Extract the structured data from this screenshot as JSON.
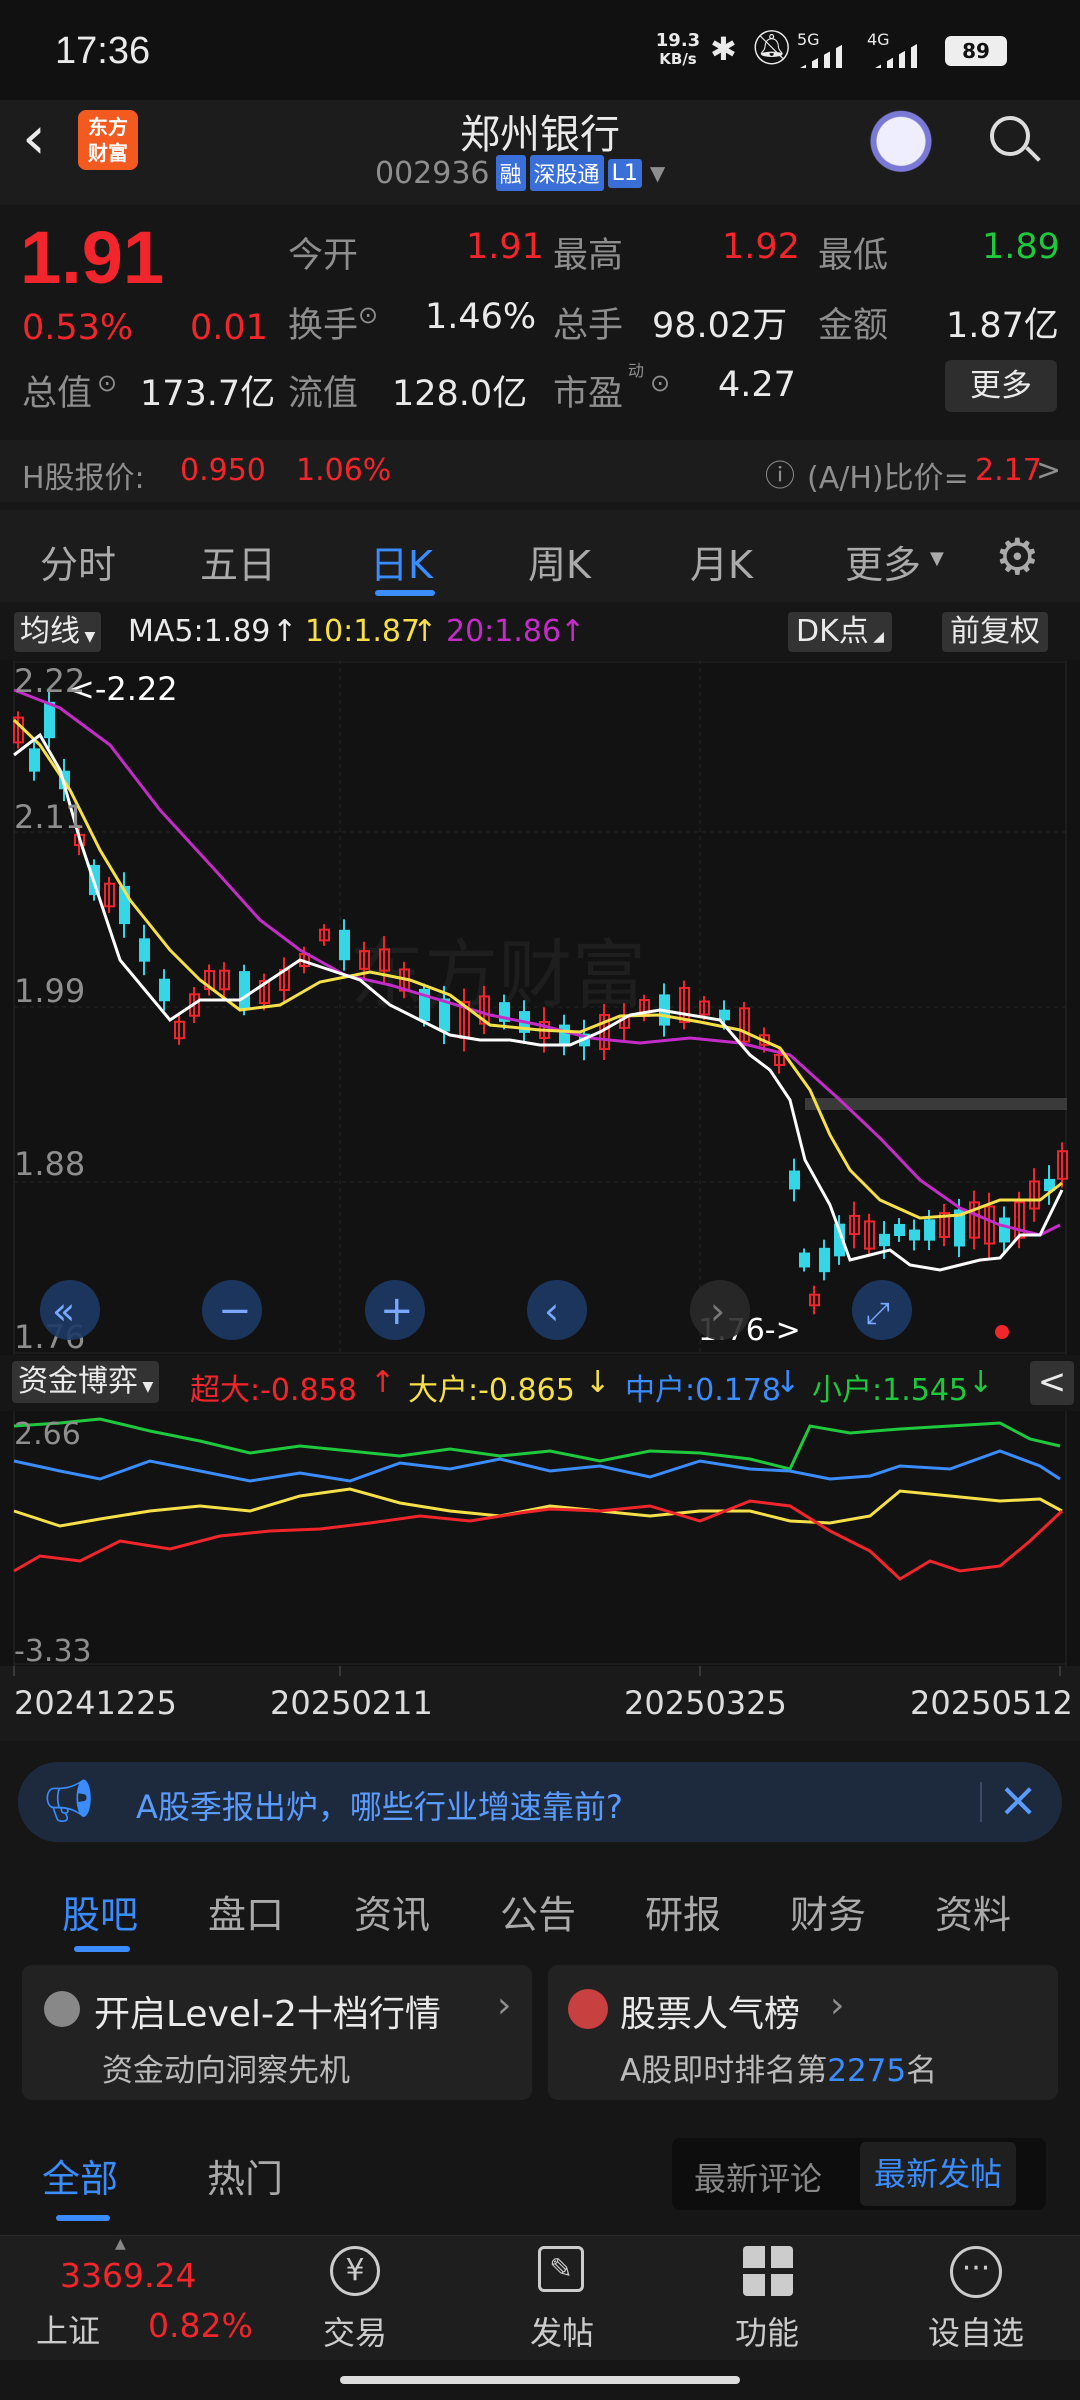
{
  "status": {
    "time": "17:36",
    "speed_top": "19.3",
    "speed_unit": "KB/s",
    "sig1": "5G",
    "sig2": "4G",
    "battery": "89"
  },
  "header": {
    "logo_line1": "东方",
    "logo_line2": "财富",
    "stock_name": "郑州银行",
    "code": "002936",
    "tag_margin": "融",
    "tag_connect": "深股通",
    "tag_level": "L1"
  },
  "quote": {
    "price": "1.91",
    "pct": "0.53%",
    "chg": "0.01",
    "open_label": "今开",
    "open": "1.91",
    "high_label": "最高",
    "high": "1.92",
    "low_label": "最低",
    "low": "1.89",
    "turnover_label": "换手",
    "turnover": "1.46%",
    "volume_label": "总手",
    "volume": "98.02万",
    "amount_label": "金额",
    "amount": "1.87亿",
    "mktcap_label": "总值",
    "mktcap": "173.7亿",
    "float_label": "流值",
    "float": "128.0亿",
    "pe_label": "市盈",
    "pe_sup": "动",
    "pe": "4.27",
    "more": "更多"
  },
  "hshare": {
    "label": "H股报价:",
    "price": "0.950",
    "pct": "1.06%",
    "ah_label": "(A/H)比价=",
    "ah_value": "2.17",
    "arrow": ">"
  },
  "tabs": [
    "分时",
    "五日",
    "日K",
    "周K",
    "月K",
    "更多"
  ],
  "active_tab": "日K",
  "ma_bar": {
    "selector": "均线",
    "ma5": "MA5:1.89",
    "ma10": "10:1.87",
    "ma20": "20:1.86",
    "up": "↑",
    "dk": "DK点",
    "adjust": "前复权"
  },
  "kchart": {
    "y_labels": [
      "2.22",
      "2.11",
      "1.99",
      "1.88",
      "1.76"
    ],
    "max_note": "<-2.22",
    "min_note": "1.76->",
    "watermark": "东方财富"
  },
  "flow_bar": {
    "selector": "资金博弈",
    "super": "超大:-0.858",
    "super_arrow": "↑",
    "large": "大户:-0.865",
    "large_arrow": "↓",
    "mid": "中户:0.178",
    "mid_arrow": "↓",
    "small": "小户:1.545",
    "small_arrow": "↓",
    "collapse": "<"
  },
  "flow_chart": {
    "y_top": "2.66",
    "y_bottom": "-3.33"
  },
  "dates": [
    "20241225",
    "20250211",
    "20250325",
    "20250512"
  ],
  "banner": {
    "text": "A股季报出炉，哪些行业增速靠前?",
    "close": "×"
  },
  "section_tabs": [
    "股吧",
    "盘口",
    "资讯",
    "公告",
    "研报",
    "财务",
    "资料"
  ],
  "active_section": "股吧",
  "cards": [
    {
      "title": "开启Level-2十档行情",
      "sub": "资金动向洞察先机"
    },
    {
      "title": "股票人气榜",
      "sub_pre": "A股即时排名第",
      "rank": "2275",
      "sub_post": "名"
    }
  ],
  "post_tabs": [
    "全部",
    "热门"
  ],
  "sort_options": [
    "最新评论",
    "最新发帖"
  ],
  "active_sort": "最新发帖",
  "bottom_nav": {
    "index_value": "3369.24",
    "index_name": "上证",
    "index_pct": "0.82%",
    "items": [
      "交易",
      "发帖",
      "功能",
      "设自选"
    ]
  },
  "colors": {
    "up": "#f0262c",
    "down": "#1fc83c",
    "accent": "#3a8cff",
    "ma5": "#ffffff",
    "ma10": "#f5e04a",
    "ma20": "#c42cc8",
    "candle_down": "#35d6e6"
  }
}
